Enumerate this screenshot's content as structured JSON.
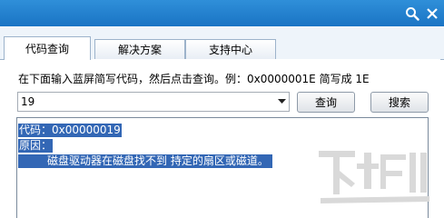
{
  "tabs": [
    {
      "label": "代码查询",
      "active": true
    },
    {
      "label": "解决方案",
      "active": false
    },
    {
      "label": "支持中心",
      "active": false
    }
  ],
  "titlebar": {
    "search_icon": "search-icon",
    "close_icon": "close-icon"
  },
  "query": {
    "instruction": "在下面输入蓝屏简写代码，然后点击查询。例：0x0000001E 简写成 1E",
    "code_value": "19",
    "query_button": "查询",
    "search_button": "搜索"
  },
  "result": {
    "code_line": "代码：0x00000019",
    "reason_label": "原因：",
    "reason_text": "磁盘驱动器在磁盘找不到 持定的扇区或磁道。"
  },
  "colors": {
    "titlebar": "#1f7dcb",
    "selection": "#3367b5",
    "tab_border": "#9db3cb"
  }
}
